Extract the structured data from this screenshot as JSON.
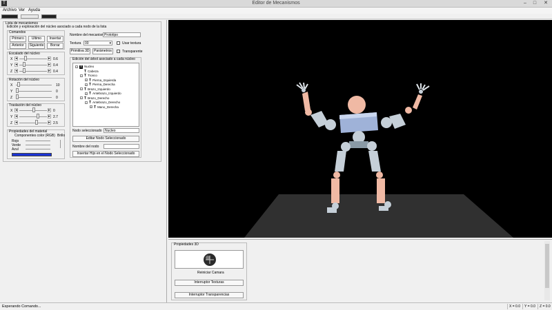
{
  "window": {
    "title": "Editor de Mecanismos",
    "app_icon": "T",
    "minimize": "–",
    "maximize": "□",
    "close": "✕"
  },
  "menu": [
    "Archivo",
    "Ver",
    "Ayuda"
  ],
  "left": {
    "list_title": "Lista de mecanismos",
    "edit_title": "Edición y exploración del núcleo asociado a cada nodo de la lista",
    "commands_title": "Comandos",
    "buttons": {
      "primero": "Primero",
      "ultimo": "Ultimo",
      "insertar": "Insertar",
      "anterior": "Anterior",
      "siguiente": "Siguiente",
      "borrar": "Borrar"
    },
    "name_label": "Nombre del mecanismo:",
    "name_value": "Prototipo",
    "texture_label": "Textura",
    "texture_value": "00",
    "use_texture": "Usar textura",
    "primitiva_btn": "Primitiva 3D",
    "parametros_btn": "Parámetros",
    "transparent": "Transparente",
    "scale_title": "Escalado del núcleo",
    "scale": [
      {
        "axis": "X",
        "value": "0.6"
      },
      {
        "axis": "Y",
        "value": "0.4"
      },
      {
        "axis": "Z",
        "value": "0.4"
      }
    ],
    "rotation_title": "Rotación del núcleo",
    "rotation": [
      {
        "axis": "X",
        "value": "10"
      },
      {
        "axis": "Y",
        "value": "0"
      },
      {
        "axis": "Z",
        "value": "0"
      }
    ],
    "translation_title": "Traslación del núcleo",
    "translation": [
      {
        "axis": "X",
        "value": "0"
      },
      {
        "axis": "Y",
        "value": "2.7"
      },
      {
        "axis": "Z",
        "value": "2.5"
      }
    ],
    "material_title": "Propiedades del material",
    "color_title": "Componentes color (RGB)",
    "brillo": "Brillo",
    "rojo": "Rojo",
    "verde": "Verde",
    "azul": "Azul",
    "color_swatch": "#1a33d6",
    "tree_title": "Edición del árbol asociado a cada núcleo",
    "tree": [
      {
        "label": "Nucleo",
        "indent": 0,
        "box": "–",
        "icon": "T"
      },
      {
        "label": "Cabeza",
        "indent": 1,
        "box": "",
        "icon": "T"
      },
      {
        "label": "Tronco",
        "indent": 1,
        "box": "–",
        "icon": "T"
      },
      {
        "label": "Pierna_Izquierda",
        "indent": 2,
        "box": "+",
        "icon": "T"
      },
      {
        "label": "Pierna_Derecha",
        "indent": 2,
        "box": "+",
        "icon": "T"
      },
      {
        "label": "Brazo_Izquierdo",
        "indent": 1,
        "box": "–",
        "icon": "T"
      },
      {
        "label": "Antebrazo_Izquierdo",
        "indent": 2,
        "box": "+",
        "icon": "T"
      },
      {
        "label": "Brazo_Derecho",
        "indent": 1,
        "box": "–",
        "icon": "T"
      },
      {
        "label": "Antebrazo_Derecho",
        "indent": 2,
        "box": "–",
        "icon": "T"
      },
      {
        "label": "Mano_Derecha",
        "indent": 3,
        "box": "+",
        "icon": "T"
      }
    ],
    "selected_label": "Nodo seleccionado",
    "selected_value": "Nucleo",
    "edit_node_btn": "Editar Nodo Seleccionado",
    "node_name_label": "Nombre del nodo",
    "insert_child_btn": "Insertar Hijo en el Nodo Seleccionado"
  },
  "props3d": {
    "title": "Propiedades 3D",
    "camera_icon": "camera-sphere-icon",
    "reset_camera": "Reiniciar Camara",
    "toggle_textures": "Interruptor Texturas",
    "toggle_transparency": "Interruptor Transparencias"
  },
  "status": {
    "text": "Esperando Comando...",
    "x": "X = 0.0",
    "y": "Y = 0.0",
    "z": "Z = 0.0"
  },
  "colors": {
    "skin": "#f0b9a4",
    "torso": "#9fb2d8",
    "joint": "#c5cfd8",
    "floor": "#303030"
  }
}
